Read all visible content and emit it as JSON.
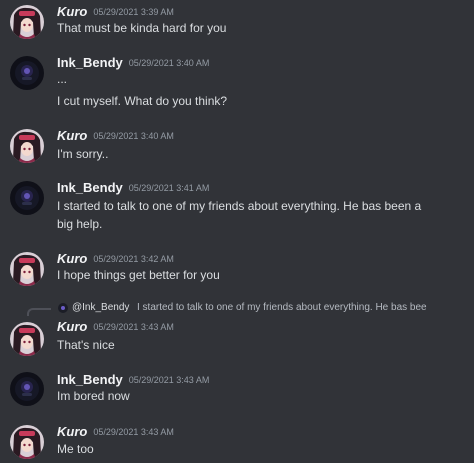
{
  "messages": [
    {
      "author": "Kuro",
      "timestamp": "05/29/2021 3:39 AM",
      "lines": [
        "That must be kinda hard for you"
      ]
    },
    {
      "author": "Ink_Bendy",
      "timestamp": "05/29/2021 3:40 AM",
      "lines": [
        "...",
        "I cut myself. What do you think?"
      ]
    },
    {
      "author": "Kuro",
      "timestamp": "05/29/2021 3:40 AM",
      "lines": [
        "I'm sorry.."
      ]
    },
    {
      "author": "Ink_Bendy",
      "timestamp": "05/29/2021 3:41 AM",
      "lines": [
        "I started to talk to one of my friends about everything. He bas been a",
        "big help."
      ]
    },
    {
      "author": "Kuro",
      "timestamp": "05/29/2021 3:42 AM",
      "lines": [
        "I hope things get better for you"
      ]
    },
    {
      "author": "Kuro",
      "timestamp": "05/29/2021 3:43 AM",
      "lines": [
        "That's nice"
      ],
      "reply": {
        "author": "@Ink_Bendy",
        "text": "I started to talk to one of my friends about everything. He bas bee"
      }
    },
    {
      "author": "Ink_Bendy",
      "timestamp": "05/29/2021 3:43 AM",
      "lines": [
        "Im bored now"
      ]
    },
    {
      "author": "Kuro",
      "timestamp": "05/29/2021 3:43 AM",
      "lines": [
        "Me too"
      ]
    }
  ]
}
